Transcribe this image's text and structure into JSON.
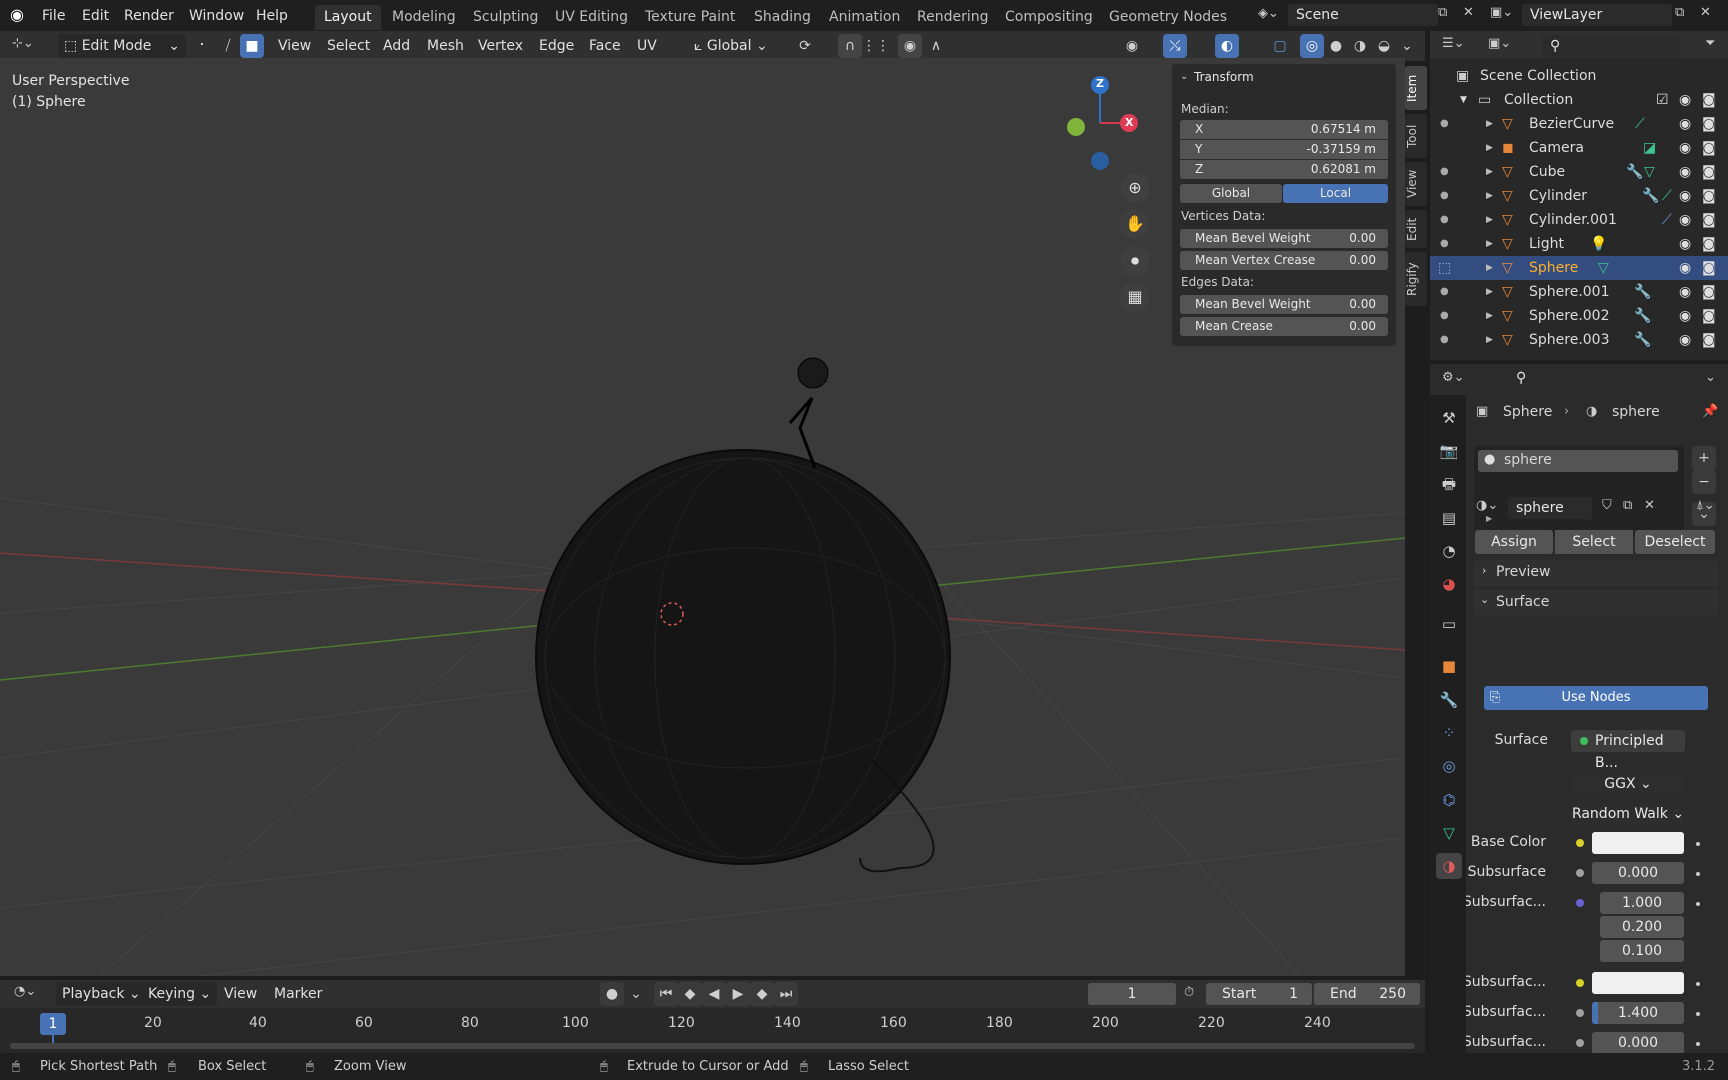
{
  "menu": {
    "file": "File",
    "edit": "Edit",
    "render": "Render",
    "window": "Window",
    "help": "Help"
  },
  "workspaces": [
    "Layout",
    "Modeling",
    "Sculpting",
    "UV Editing",
    "Texture Paint",
    "Shading",
    "Animation",
    "Rendering",
    "Compositing",
    "Geometry Nodes"
  ],
  "scene": {
    "name": "Scene",
    "view_layer": "ViewLayer"
  },
  "header3d": {
    "mode": "Edit Mode",
    "view": "View",
    "select": "Select",
    "add": "Add",
    "mesh": "Mesh",
    "vertex": "Vertex",
    "edge": "Edge",
    "face": "Face",
    "uv": "UV",
    "orientation": "Global"
  },
  "viewport": {
    "perspective": "User Perspective",
    "object": "(1) Sphere",
    "bg": "#3a3a3a"
  },
  "gizmo": {
    "z": "Z",
    "x": "X"
  },
  "npanel": {
    "title": "Transform",
    "median": "Median:",
    "x_label": "X",
    "x_value": "0.67514 m",
    "y_label": "Y",
    "y_value": "-0.37159 m",
    "z_label": "Z",
    "z_value": "0.62081 m",
    "global": "Global",
    "local": "Local",
    "vertices_data": "Vertices Data:",
    "mean_bevel_weight": "Mean Bevel Weight",
    "mean_bevel_weight_value": "0.00",
    "mean_vertex_crease": "Mean Vertex Crease",
    "mean_vertex_crease_value": "0.00",
    "edges_data": "Edges Data:",
    "edge_mean_bevel_weight": "Mean Bevel Weight",
    "edge_mean_bevel_weight_value": "0.00",
    "mean_crease": "Mean Crease",
    "mean_crease_value": "0.00"
  },
  "sidetabs": [
    "Item",
    "Tool",
    "View",
    "Edit",
    "Rigify"
  ],
  "outliner": {
    "scene_collection": "Scene Collection",
    "collection": "Collection",
    "items": [
      "BezierCurve",
      "Camera",
      "Cube",
      "Cylinder",
      "Cylinder.001",
      "Light",
      "Sphere",
      "Sphere.001",
      "Sphere.002",
      "Sphere.003"
    ],
    "selected": "Sphere"
  },
  "properties": {
    "breadcrumb_object": "Sphere",
    "breadcrumb_material": "sphere",
    "slot": "sphere",
    "material_name": "sphere",
    "assign": "Assign",
    "select": "Select",
    "deselect": "Deselect",
    "preview": "Preview",
    "surface_panel": "Surface",
    "use_nodes": "Use Nodes",
    "surface_label": "Surface",
    "surface_value": "Principled B...",
    "distribution": "GGX",
    "subsurface_method": "Random Walk",
    "base_color_label": "Base Color",
    "subsurface_label": "Subsurface",
    "subsurface_value": "0.000",
    "subsurface_radius_label": "Subsurfac...",
    "radius_values": [
      "1.000",
      "0.200",
      "0.100"
    ],
    "subsurface_color_label": "Subsurfac...",
    "subsurface_ior_label": "Subsurfac...",
    "subsurface_ior_value": "1.400",
    "subsurface_aniso_label": "Subsurfac...",
    "subsurface_aniso_value": "0.000"
  },
  "timeline": {
    "playback": "Playback",
    "keying": "Keying",
    "view": "View",
    "marker": "Marker",
    "current_frame": "1",
    "start_label": "Start",
    "start": "1",
    "end_label": "End",
    "end": "250",
    "ticks": [
      "1",
      "20",
      "40",
      "60",
      "80",
      "100",
      "120",
      "140",
      "160",
      "180",
      "200",
      "220",
      "240"
    ]
  },
  "status": {
    "pick": "Pick Shortest Path",
    "box": "Box Select",
    "zoom": "Zoom View",
    "extrude": "Extrude to Cursor or Add",
    "lasso": "Lasso Select",
    "version": "3.1.2"
  }
}
